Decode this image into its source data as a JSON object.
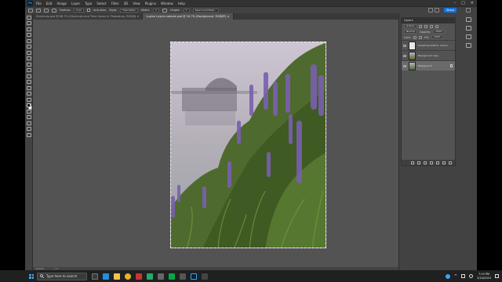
{
  "app": {
    "name": "Adobe Photoshop",
    "logo_text": "Ps"
  },
  "menu": [
    "File",
    "Edit",
    "Image",
    "Layer",
    "Type",
    "Select",
    "Filter",
    "3D",
    "View",
    "Plugins",
    "Window",
    "Help"
  ],
  "window_controls": [
    "–",
    "□",
    "×"
  ],
  "options_bar": {
    "feather_label": "Feather:",
    "feather_value": "0 px",
    "antialias_label": "Anti-alias",
    "style_label": "Style:",
    "style_value": "Fixed Ratio",
    "width_label": "Width:",
    "width_value": "1",
    "height_label": "Height:",
    "height_value": "1",
    "select_subject": "Select and Mask...",
    "share": "Share"
  },
  "tabs": [
    {
      "label": "Shortcuts.psd @ 66.7% (Shortcuts and Time Saves in Photoshop, RGB/8) ×",
      "active": false
    },
    {
      "label": "Lupine Layers sample.psd @ 16.7% (Background, RGB/8*) ×",
      "active": true
    }
  ],
  "status_bar": {
    "zoom": "16.67%",
    "info": "> 3 "
  },
  "layers_panel": {
    "title": "Layers",
    "kind_label": "Q Kind",
    "blend_mode": "Normal",
    "opacity_label": "Opacity:",
    "opacity_value": "100%",
    "lock_label": "Lock:",
    "fill_label": "Fill:",
    "fill_value": "100%",
    "layers": [
      {
        "name": "Grad/Hue bottom, moors",
        "selected": false
      },
      {
        "name": "Background copy",
        "selected": false
      },
      {
        "name": "Background",
        "selected": true
      }
    ]
  },
  "taskbar": {
    "search_placeholder": "Type here to search",
    "time": "7:15 PM",
    "date": "2/24/2023",
    "colors": {
      "ps": "#001e36",
      "edge": "#1f8fe3",
      "chrome": "#e8b22a",
      "folder": "#f2c14e"
    }
  }
}
